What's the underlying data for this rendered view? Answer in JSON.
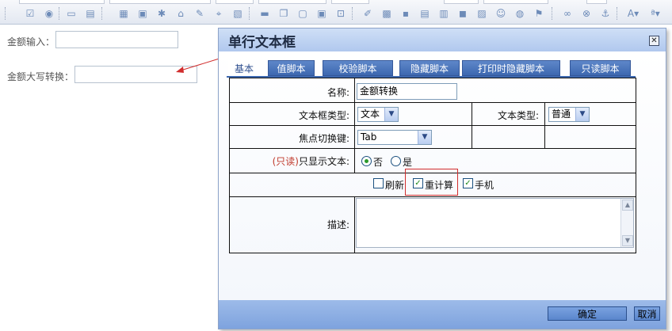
{
  "toolbar": {
    "icons": [
      "checkbox-icon",
      "radio-icon",
      "textbox-icon",
      "listbox-icon",
      "table-icon",
      "calendar-icon",
      "macro-icon",
      "bank-icon",
      "sign-icon",
      "select-icon",
      "image-icon",
      "line-icon",
      "copy-icon",
      "paste-icon",
      "frame-icon",
      "zoom-icon",
      "link-icon",
      "grid-icon",
      "image2-icon",
      "layout-icon",
      "media-icon",
      "flash-icon",
      "picture-icon",
      "smiley-icon",
      "globe-icon",
      "chain-icon",
      "unlink-icon",
      "anchor-icon",
      "font-color-icon",
      "spell-check-icon"
    ]
  },
  "page": {
    "amount_label": "金额输入：",
    "amount_upper_label": "金额大写转换："
  },
  "dialog": {
    "title": "单行文本框",
    "close_glyph": "✕",
    "tabs": [
      {
        "label": "基本",
        "active": true
      },
      {
        "label": "值脚本",
        "active": false
      },
      {
        "label": "校验脚本",
        "active": false
      },
      {
        "label": "隐藏脚本",
        "active": false
      },
      {
        "label": "打印时隐藏脚本",
        "active": false
      },
      {
        "label": "只读脚本",
        "active": false
      }
    ],
    "form": {
      "name_label": "名称:",
      "name_value": "金额转换",
      "textbox_type_label": "文本框类型:",
      "textbox_type_value": "文本",
      "text_type_label": "文本类型:",
      "text_type_value": "普通",
      "focus_key_label": "焦点切换键:",
      "focus_key_value": "Tab",
      "readonly_prefix": "(只读)",
      "readonly_label": "只显示文本:",
      "radio_no": "否",
      "radio_yes": "是",
      "radio_selected": "否",
      "check_refresh": "刷新",
      "check_recalc": "重计算",
      "check_mobile": "手机",
      "checks_state": {
        "refresh": false,
        "recalc": true,
        "mobile": true
      },
      "desc_label": "描述:"
    },
    "buttons": {
      "ok": "确定",
      "cancel": "取消"
    }
  },
  "colors": {
    "accent": "#3d68b0",
    "title_bar": "#b0c8ee",
    "footer": "#86a9df",
    "highlight": "#d12d2d"
  }
}
